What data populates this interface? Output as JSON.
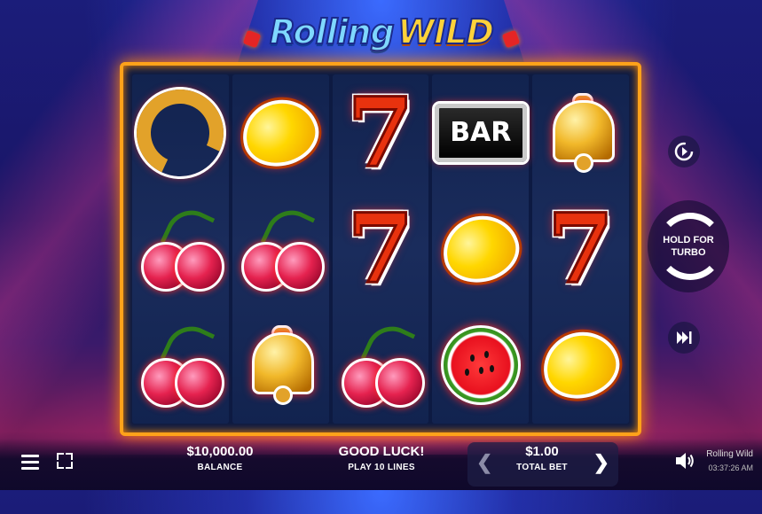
{
  "logo": {
    "word1": "Rolling",
    "word2": "WILD"
  },
  "reels": [
    [
      "horseshoe",
      "cherries",
      "cherries"
    ],
    [
      "lemon",
      "cherries",
      "bell"
    ],
    [
      "seven",
      "seven",
      "cherries"
    ],
    [
      "bar",
      "lemon",
      "watermelon"
    ],
    [
      "bell",
      "seven",
      "lemon"
    ]
  ],
  "symbols": {
    "bar_label": "BAR",
    "seven_label": "7"
  },
  "controls": {
    "autoplay_icon": "autoplay-icon",
    "spin_label": "HOLD FOR TURBO",
    "turbo_icon": "fast-forward-icon"
  },
  "bottom": {
    "balance_value": "$10,000.00",
    "balance_label": "BALANCE",
    "message": "GOOD LUCK!",
    "message_sub": "PLAY 10 LINES",
    "bet_value": "$1.00",
    "bet_label": "TOTAL BET",
    "game_name": "Rolling Wild",
    "time": "03:37:26 AM"
  },
  "colors": {
    "frame": "#ffa21a",
    "accent": "#ffd23a"
  }
}
